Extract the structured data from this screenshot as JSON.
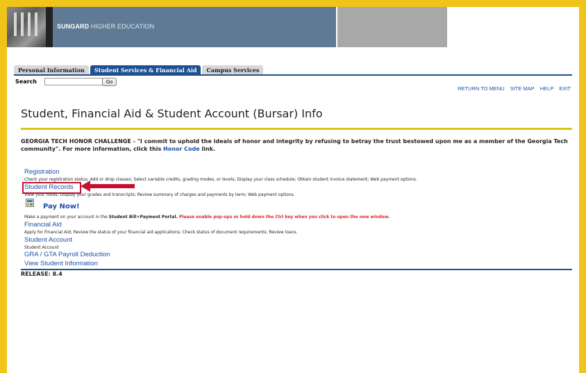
{
  "banner": {
    "logo_bold": "SUNGARD",
    "logo_light": " HIGHER EDUCATION"
  },
  "tabs": [
    {
      "label": "Personal Information",
      "active": false
    },
    {
      "label": "Student Services & Financial Aid",
      "active": true
    },
    {
      "label": "Campus Services",
      "active": false
    }
  ],
  "search": {
    "label": "Search",
    "value": "",
    "go_label": "Go"
  },
  "toplinks": [
    "RETURN TO MENU",
    "SITE MAP",
    "HELP",
    "EXIT"
  ],
  "page_title": "Student, Financial Aid & Student Account (Bursar) Info",
  "honor": {
    "text": "GEORGIA TECH HONOR CHALLENGE - \"I commit to uphold the ideals of honor and integrity by refusing to betray the trust bestowed upon me as a member of the Georgia Tech community\". For more information, click this ",
    "link": "Honor Code",
    "tail": " link."
  },
  "menu": {
    "registration": {
      "label": "Registration",
      "desc": "Check your registration status; Add or drop classes; Select variable credits, grading modes, or levels; Display your class schedule; Obtain student invoice statement; Web payment options."
    },
    "student_records": {
      "label": "Student Records",
      "desc": "View your holds; Display your grades and transcripts; Review summary of charges and payments by term; Web payment options."
    },
    "pay_now": {
      "label": "Pay Now!",
      "desc_pre": "Make a payment on your account in the ",
      "desc_bold": "Student Bill+Payment Portal.",
      "desc_red": " Please enable pop-ups or hold down the Ctrl key when you click to open the new window."
    },
    "financial_aid": {
      "label": "Financial Aid",
      "desc": "Apply for Financial Aid; Review the status of your financial aid applications; Check status of document requirements; Review loans."
    },
    "student_account": {
      "label": "Student Account",
      "desc": "Student Account"
    },
    "gra_gta": {
      "label": "GRA / GTA Payroll Deduction"
    },
    "view_info": {
      "label": "View Student Information"
    }
  },
  "release": "RELEASE: 8.4",
  "colors": {
    "frame": "#f0c419",
    "tab_active": "#1d4f91",
    "link": "#1d4fa8",
    "highlight": "#c8102e",
    "rule_gold": "#d9c51a"
  }
}
